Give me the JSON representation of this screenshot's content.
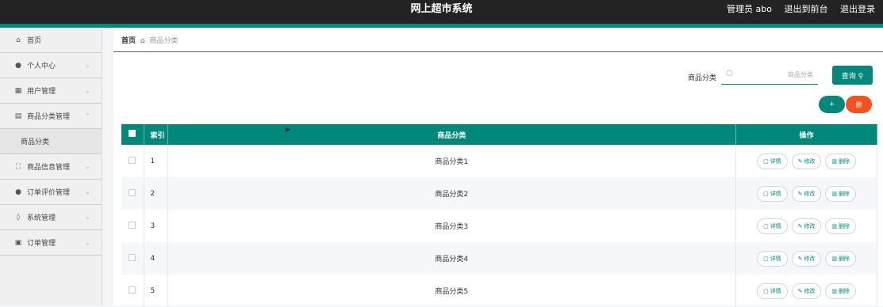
{
  "app": {
    "title": "网上超市系统",
    "admin": "管理员 abo",
    "to_front": "退出到前台",
    "logout": "退出登录"
  },
  "sidebar": {
    "items": [
      {
        "label": "首页",
        "icon": "home-icon"
      },
      {
        "label": "个人中心",
        "icon": "user-icon"
      },
      {
        "label": "用户管理",
        "icon": "grid-icon"
      },
      {
        "label": "商品分类管理",
        "icon": "store-icon"
      },
      {
        "label": "商品分类",
        "icon": ""
      },
      {
        "label": "商品信息管理",
        "icon": "scan-icon"
      },
      {
        "label": "订单评价管理",
        "icon": "user-icon"
      },
      {
        "label": "系统管理",
        "icon": "bulb-icon"
      },
      {
        "label": "订单管理",
        "icon": "clipboard-icon"
      }
    ]
  },
  "breadcrumb": {
    "home": "首页",
    "current": "商品分类"
  },
  "search": {
    "label": "商品分类",
    "placeholder": "商品分类",
    "button": "查询"
  },
  "actions": {
    "add": "+",
    "delete": "删"
  },
  "table": {
    "headers": [
      "索引",
      "商品分类",
      "操作"
    ],
    "rows": [
      {
        "index": "1",
        "name": "商品分类1"
      },
      {
        "index": "2",
        "name": "商品分类2"
      },
      {
        "index": "3",
        "name": "商品分类3"
      },
      {
        "index": "4",
        "name": "商品分类4"
      },
      {
        "index": "5",
        "name": "商品分类5"
      }
    ],
    "ops": {
      "detail": "详情",
      "edit": "修改",
      "delete": "删除"
    }
  },
  "colors": {
    "accent": "#00897b",
    "danger": "#f4511e",
    "topbar": "#232323"
  }
}
